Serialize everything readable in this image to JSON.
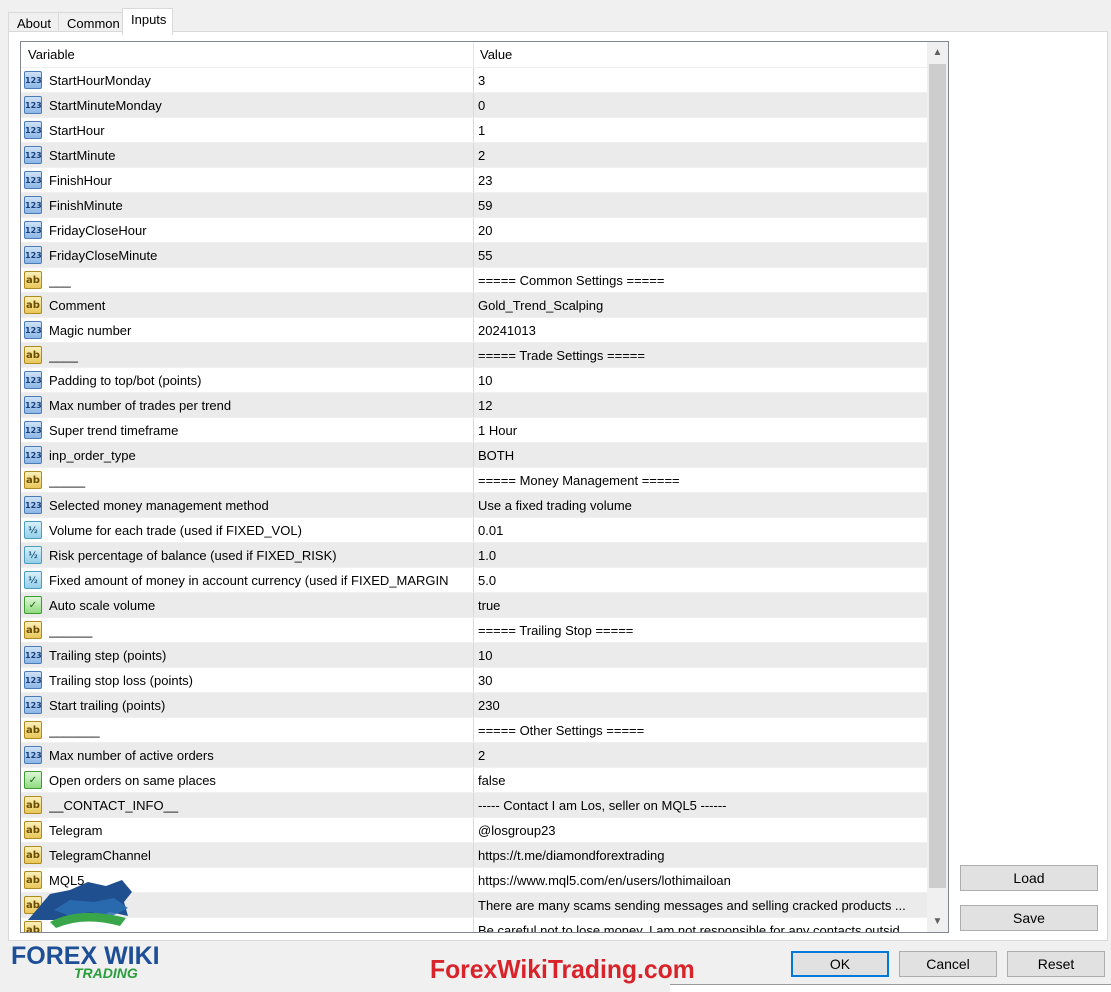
{
  "tabs": [
    {
      "label": "About",
      "active": false
    },
    {
      "label": "Common",
      "active": false
    },
    {
      "label": "Inputs",
      "active": true
    }
  ],
  "grid": {
    "headers": {
      "variable": "Variable",
      "value": "Value"
    },
    "rows": [
      {
        "type": "num",
        "icon": "integer-icon",
        "name": "StartHourMonday",
        "value": "3"
      },
      {
        "type": "num",
        "icon": "integer-icon",
        "name": "StartMinuteMonday",
        "value": "0"
      },
      {
        "type": "num",
        "icon": "integer-icon",
        "name": "StartHour",
        "value": "1"
      },
      {
        "type": "num",
        "icon": "integer-icon",
        "name": "StartMinute",
        "value": "2"
      },
      {
        "type": "num",
        "icon": "integer-icon",
        "name": "FinishHour",
        "value": "23"
      },
      {
        "type": "num",
        "icon": "integer-icon",
        "name": "FinishMinute",
        "value": "59"
      },
      {
        "type": "num",
        "icon": "integer-icon",
        "name": "FridayCloseHour",
        "value": "20"
      },
      {
        "type": "num",
        "icon": "integer-icon",
        "name": "FridayCloseMinute",
        "value": "55"
      },
      {
        "type": "str",
        "icon": "string-icon",
        "name": "___",
        "value": "===== Common Settings ====="
      },
      {
        "type": "str",
        "icon": "string-icon",
        "name": "Comment",
        "value": "Gold_Trend_Scalping"
      },
      {
        "type": "num",
        "icon": "integer-icon",
        "name": "Magic number",
        "value": "20241013"
      },
      {
        "type": "str",
        "icon": "string-icon",
        "name": "____",
        "value": "===== Trade Settings ====="
      },
      {
        "type": "num",
        "icon": "integer-icon",
        "name": "Padding to top/bot (points)",
        "value": "10"
      },
      {
        "type": "num",
        "icon": "integer-icon",
        "name": "Max number of trades per trend",
        "value": "12"
      },
      {
        "type": "num",
        "icon": "integer-icon",
        "name": "Super trend timeframe",
        "value": "1 Hour"
      },
      {
        "type": "num",
        "icon": "integer-icon",
        "name": "inp_order_type",
        "value": "BOTH"
      },
      {
        "type": "str",
        "icon": "string-icon",
        "name": "_____",
        "value": "===== Money Management ====="
      },
      {
        "type": "num",
        "icon": "integer-icon",
        "name": "Selected money management method",
        "value": "Use a fixed trading volume"
      },
      {
        "type": "dbl",
        "icon": "double-icon",
        "name": "Volume for each trade (used if FIXED_VOL)",
        "value": "0.01"
      },
      {
        "type": "dbl",
        "icon": "double-icon",
        "name": "Risk percentage of balance (used if FIXED_RISK)",
        "value": "1.0"
      },
      {
        "type": "dbl",
        "icon": "double-icon",
        "name": "Fixed amount of money in account currency (used if FIXED_MARGIN",
        "value": "5.0"
      },
      {
        "type": "bool",
        "icon": "boolean-icon",
        "name": "Auto scale volume",
        "value": "true"
      },
      {
        "type": "str",
        "icon": "string-icon",
        "name": "______",
        "value": "===== Trailing Stop ====="
      },
      {
        "type": "num",
        "icon": "integer-icon",
        "name": "Trailing step (points)",
        "value": "10"
      },
      {
        "type": "num",
        "icon": "integer-icon",
        "name": "Trailing stop loss (points)",
        "value": "30"
      },
      {
        "type": "num",
        "icon": "integer-icon",
        "name": "Start trailing (points)",
        "value": "230"
      },
      {
        "type": "str",
        "icon": "string-icon",
        "name": "_______",
        "value": "===== Other Settings  ====="
      },
      {
        "type": "num",
        "icon": "integer-icon",
        "name": "Max number of active orders",
        "value": "2"
      },
      {
        "type": "bool",
        "icon": "boolean-icon",
        "name": "Open orders on same places",
        "value": "false"
      },
      {
        "type": "str",
        "icon": "string-icon",
        "name": "__CONTACT_INFO__",
        "value": "----- Contact I am Los, seller on MQL5 ------"
      },
      {
        "type": "str",
        "icon": "string-icon",
        "name": "Telegram",
        "value": "@losgroup23"
      },
      {
        "type": "str",
        "icon": "string-icon",
        "name": "TelegramChannel",
        "value": "https://t.me/diamondforextrading"
      },
      {
        "type": "str",
        "icon": "string-icon",
        "name": "MQL5",
        "value": "https://www.mql5.com/en/users/lothimailoan"
      },
      {
        "type": "str",
        "icon": "string-icon",
        "name": "",
        "value": "There are many scams sending messages and selling cracked products ..."
      },
      {
        "type": "str",
        "icon": "string-icon",
        "name": "",
        "value": "Be careful not to lose money. I am not responsible for any contacts outsid"
      }
    ]
  },
  "buttons": {
    "load": "Load",
    "save": "Save",
    "ok": "OK",
    "cancel": "Cancel",
    "reset": "Reset"
  },
  "watermark": "ForexWikiTrading.com",
  "logo": {
    "line1": "FOREX WIKI",
    "line2": "TRADING"
  }
}
